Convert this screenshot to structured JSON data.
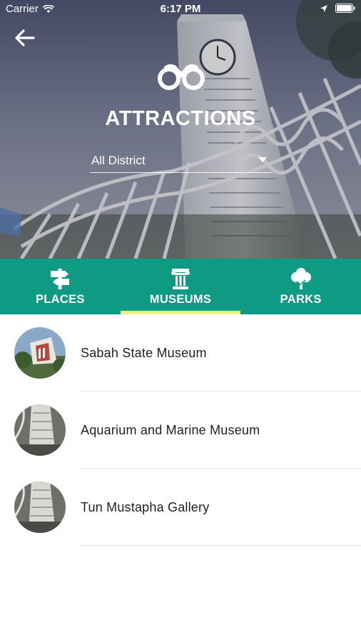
{
  "status_bar": {
    "carrier": "Carrier",
    "time": "6:17 PM",
    "icons": [
      "wifi-icon",
      "location-arrow-icon",
      "battery-icon"
    ]
  },
  "header": {
    "back_icon": "arrow-left-icon",
    "title": "ATTRACTIONS",
    "icon": "binoculars-icon",
    "district_select": {
      "value": "All District",
      "icon": "dropdown-caret-icon"
    }
  },
  "tabs": [
    {
      "label": "PLACES",
      "icon": "signpost-icon",
      "active": false
    },
    {
      "label": "MUSEUMS",
      "icon": "column-pillar-icon",
      "active": true
    },
    {
      "label": "PARKS",
      "icon": "tree-icon",
      "active": false
    }
  ],
  "list": {
    "items": [
      {
        "name": "Sabah State Museum"
      },
      {
        "name": "Aquarium and Marine Museum"
      },
      {
        "name": "Tun Mustapha Gallery"
      }
    ]
  },
  "colors": {
    "tab_bar": "#0f9a84",
    "active_indicator": "#f2f089",
    "text_primary": "#222222",
    "divider": "#e4e4e4"
  }
}
